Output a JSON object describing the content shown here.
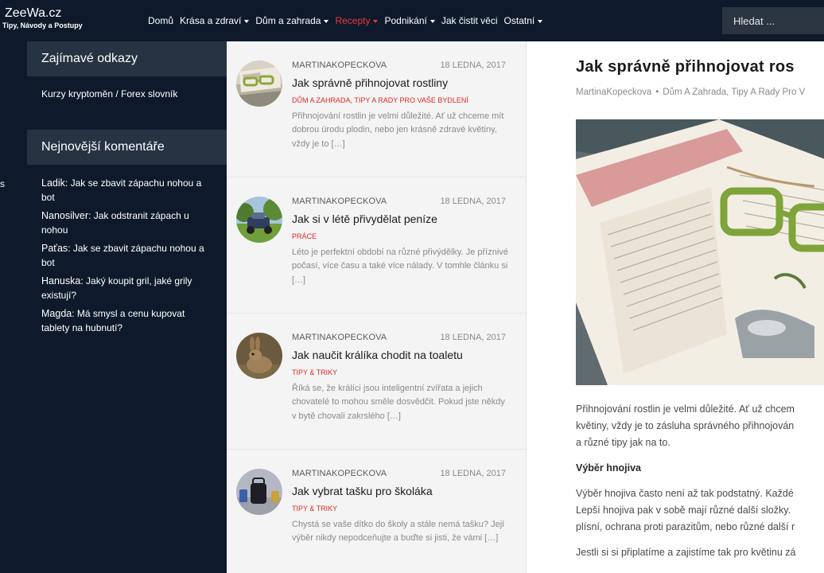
{
  "site": {
    "name": "ZeeWa.cz",
    "tagline": "Tipy, Návody a Postupy"
  },
  "nav": {
    "items": [
      {
        "label": "Domů",
        "dropdown": false,
        "active": false
      },
      {
        "label": "Krása a zdraví",
        "dropdown": true,
        "active": false
      },
      {
        "label": "Dům a zahrada",
        "dropdown": true,
        "active": false
      },
      {
        "label": "Recepty",
        "dropdown": true,
        "active": true
      },
      {
        "label": "Podnikání",
        "dropdown": true,
        "active": false
      },
      {
        "label": "Jak čistit věci",
        "dropdown": false,
        "active": false
      },
      {
        "label": "Ostatní",
        "dropdown": true,
        "active": false
      }
    ],
    "search_placeholder": "Hledat ..."
  },
  "leftstrip_text": "s",
  "sidebar": {
    "links_heading": "Zajímavé odkazy",
    "link": "Kurzy kryptoměn / Forex slovník",
    "comments_heading": "Nejnovější komentáře",
    "comments": [
      {
        "author": "Ladik",
        "post": "Jak se zbavit zápachu nohou a bot"
      },
      {
        "author": "Nanosilver",
        "post": "Jak odstranit zápach u nohou"
      },
      {
        "author": "Paťas",
        "post": "Jak se zbavit zápachu nohou a bot"
      },
      {
        "author": "Hanuska",
        "post": "Jaký koupit gril, jaké grily existují?"
      },
      {
        "author": "Magda",
        "post": "Má smysl a cenu kupovat tablety na hubnutí?"
      }
    ]
  },
  "posts": [
    {
      "author": "MARTINAKOPECKOVA",
      "date": "18 LEDNA, 2017",
      "title": "Jak správně přihnojovat rostliny",
      "categories": "DŮM A ZAHRADA, TIPY A RADY PRO VAŠE BYDLENÍ",
      "excerpt": "Přihnojování rostlin je velmi důležité. Ať už chceme mít dobrou úrodu plodin, nebo jen krásně zdravé květiny, vždy je to […]",
      "thumb": "glasses-book"
    },
    {
      "author": "MARTINAKOPECKOVA",
      "date": "18 LEDNA, 2017",
      "title": "Jak si v létě přivydělat peníze",
      "categories": "PRÁCE",
      "excerpt": "Léto je perfektní období na různé přivýdělky. Je příznivé počasí, více času a také více nálady. V tomhle článku si […]",
      "thumb": "lawn-mower"
    },
    {
      "author": "MARTINAKOPECKOVA",
      "date": "18 LEDNA, 2017",
      "title": "Jak naučit králíka chodit na toaletu",
      "categories": "TIPY & TRIKY",
      "excerpt": "Říká se, že králíci jsou inteligentní zvířata a jejich chovatelé to mohou směle dosvědčit. Pokud jste někdy v bytě chovali zakrslého […]",
      "thumb": "rabbit"
    },
    {
      "author": "MARTINAKOPECKOVA",
      "date": "18 LEDNA, 2017",
      "title": "Jak vybrat tašku pro školáka",
      "categories": "TIPY & TRIKY",
      "excerpt": "Chystá se vaše dítko do školy a stále nemá tašku? Její výběr nikdy nepodceňujte a buďte si jisti, že vámi […]",
      "thumb": "school-bag"
    }
  ],
  "article": {
    "title": "Jak správně přihnojovat ros",
    "meta_author": "MartinaKopeckova",
    "meta_categories": "Dům A Zahrada, Tipy A Rady Pro V",
    "image": "book-with-glasses",
    "body": {
      "p1_line1": "Přihnojování rostlin je velmi důležité. Ať už chcem",
      "p1_line2": "květiny, vždy je to zásluha správného přihnojován",
      "p1_line3": "a různé tipy jak na to.",
      "h1": "Výběr hnojiva",
      "p2_line1": "Výběr hnojiva často není až tak podstatný. Každé",
      "p2_line2": "Lepší hnojiva pak v sobě mají různé další složky.",
      "p2_line3": "plísní, ochrana proti parazitům, nebo různé další r",
      "p3_line1": "Jestli si si připlatíme a zajistíme tak pro květinu zá"
    }
  },
  "colors": {
    "nav_bg": "#0e1a2c",
    "sidebar_head_bg": "#263342",
    "accent_red": "#e02828",
    "list_bg": "#f4f4f4"
  }
}
